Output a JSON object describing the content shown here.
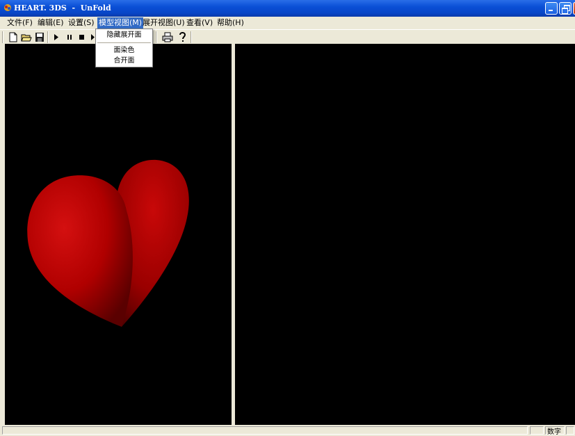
{
  "window": {
    "title": "HEART. 3DS  -  UnFold"
  },
  "menubar": {
    "items": [
      {
        "label": "文件(F)"
      },
      {
        "label": "编辑(E)"
      },
      {
        "label": "设置(S)"
      },
      {
        "label": "模型视图(M)"
      },
      {
        "label": "展开视图(U)"
      },
      {
        "label": "查看(V)"
      },
      {
        "label": "帮助(H)"
      }
    ]
  },
  "dropdown": {
    "items": [
      {
        "label": "隐藏展开面"
      },
      {
        "label": "面染色"
      },
      {
        "label": "合开面"
      }
    ]
  },
  "toolbar": {
    "icons": [
      "new-file-icon",
      "open-folder-icon",
      "save-icon",
      "play-icon",
      "pause-icon",
      "stop-icon",
      "step-icon",
      "print-icon",
      "help-icon"
    ]
  },
  "statusbar": {
    "num_indicator": "数字"
  },
  "colors": {
    "titlebar": "#0a4fd6",
    "menu_highlight": "#316ac5",
    "heart_red": "#b00000",
    "viewport_bg": "#000000"
  }
}
